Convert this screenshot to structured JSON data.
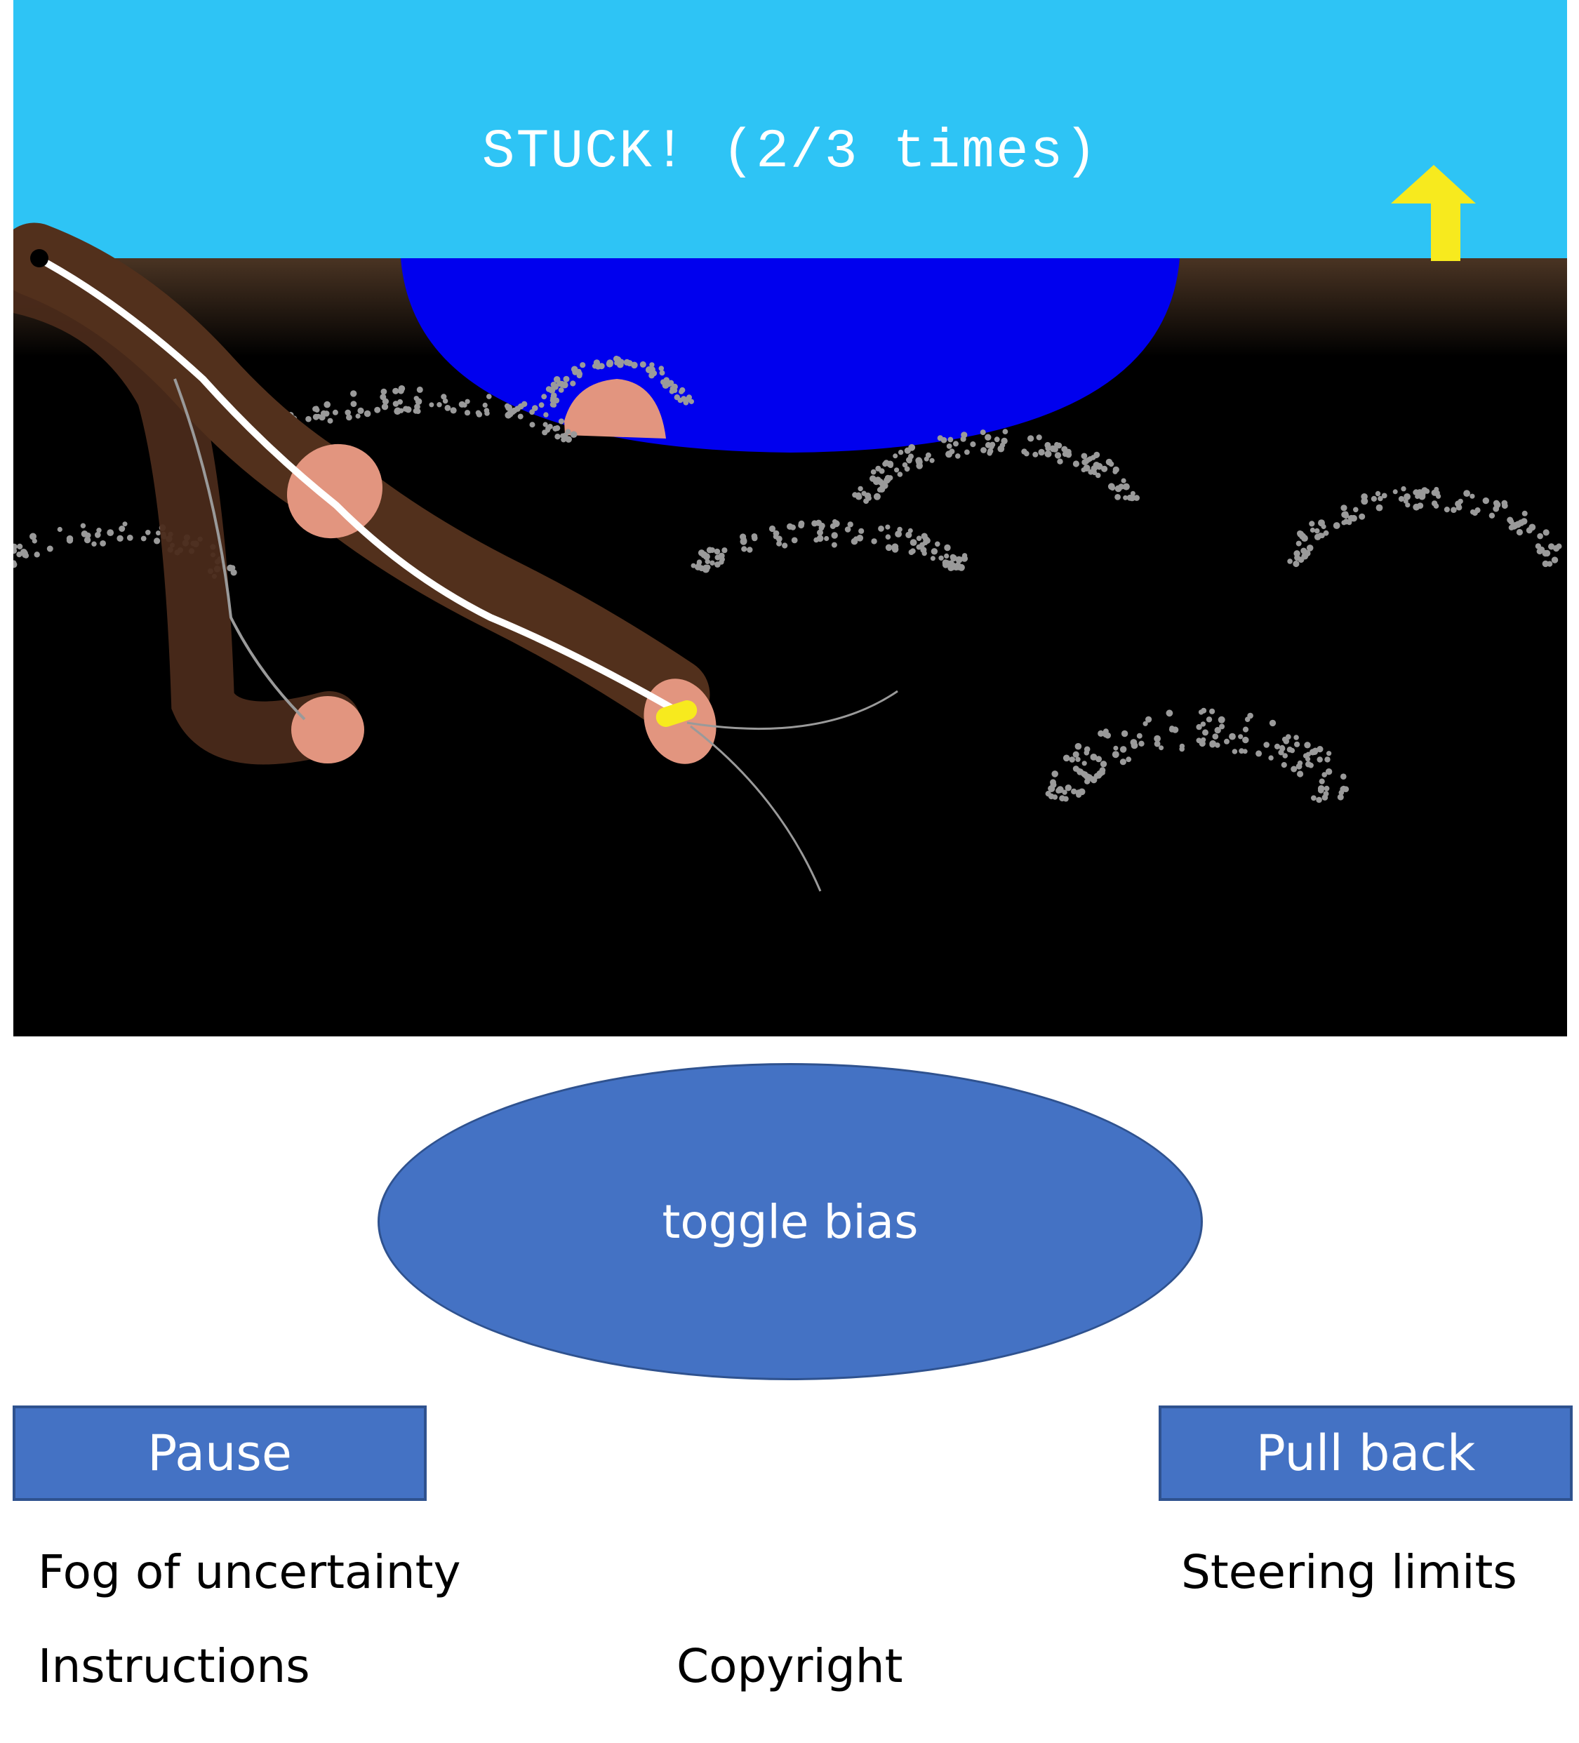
{
  "game": {
    "status_text": "STUCK! (2/3 times)",
    "colors": {
      "sky": "#2ec4f5",
      "water": "#0000ee",
      "root": "#4f2b18",
      "root_tip": "#e2957f",
      "needle_path": "#ffffff",
      "needle_tip": "#f7ea1e",
      "arrow": "#f7ea1e",
      "fog": "#9a9a9a"
    },
    "icons": [
      "up-arrow-icon",
      "needle-tip-icon",
      "entry-point-icon"
    ]
  },
  "controls": {
    "toggle_bias_label": "toggle bias",
    "pause_label": "Pause",
    "pull_back_label": "Pull back"
  },
  "links": {
    "fog": "Fog of uncertainty",
    "steering": "Steering limits",
    "instructions": "Instructions",
    "copyright": "Copyright"
  }
}
